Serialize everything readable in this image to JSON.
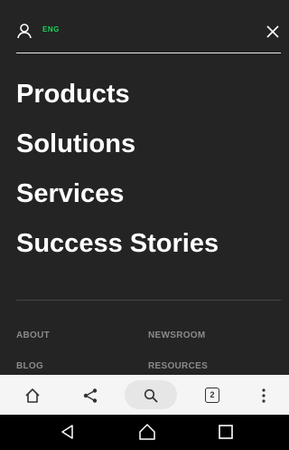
{
  "header": {
    "language": "ENG"
  },
  "menu": {
    "items": [
      "Products",
      "Solutions",
      "Services",
      "Success Stories"
    ]
  },
  "footer": {
    "links": [
      "ABOUT",
      "NEWSROOM",
      "BLOG",
      "RESOURCES"
    ]
  },
  "browser": {
    "tab_count": "2"
  },
  "colors": {
    "menu_bg": "#242424",
    "accent": "#1fd15a"
  },
  "icons": [
    "user-icon",
    "close-icon",
    "home-icon",
    "share-icon",
    "search-icon",
    "tabs-icon",
    "more-icon",
    "back-icon",
    "android-home-icon",
    "recents-icon"
  ]
}
